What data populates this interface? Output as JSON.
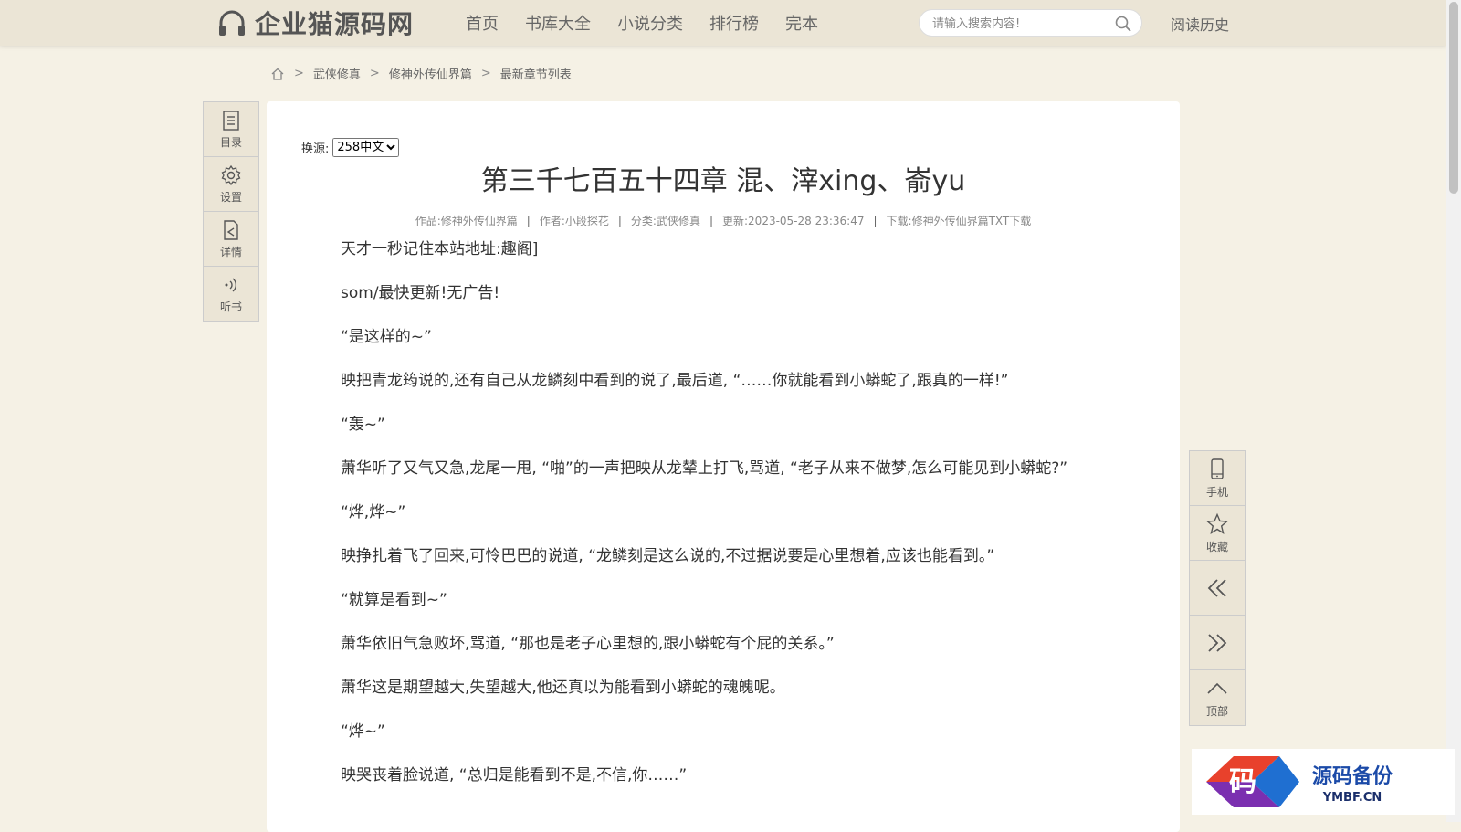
{
  "header": {
    "logo_text": "企业猫源码网",
    "nav": [
      "首页",
      "书库大全",
      "小说分类",
      "排行榜",
      "完本"
    ],
    "search_placeholder": "请输入搜索内容!",
    "history": "阅读历史"
  },
  "breadcrumb": [
    "武侠修真",
    "修神外传仙界篇",
    "最新章节列表"
  ],
  "left_tools": [
    {
      "icon": "list-icon",
      "label": "目录"
    },
    {
      "icon": "gear-icon",
      "label": "设置"
    },
    {
      "icon": "detail-icon",
      "label": "详情"
    },
    {
      "icon": "audio-icon",
      "label": "听书"
    }
  ],
  "source": {
    "label": "换源:",
    "selected": "258中文"
  },
  "chapter": {
    "title": "第三千七百五十四章 混、滓xing、嵛yu",
    "meta": [
      "作品:修神外传仙界篇",
      "作者:小段探花",
      "分类:武侠修真",
      "更新:2023-05-28 23:36:47",
      "下载:修神外传仙界篇TXT下载"
    ],
    "paragraphs": [
      "天才一秒记住本站地址:趣阁]",
      "som/最快更新!无广告!",
      "“是这样的~”",
      "映把青龙筠说的,还有自己从龙鳞刻中看到的说了,最后道, “……你就能看到小蟒蛇了,跟真的一样!”",
      "“轰~”",
      "萧华听了又气又急,龙尾一甩, “啪”的一声把映从龙辇上打飞,骂道, “老子从来不做梦,怎么可能见到小蟒蛇?”",
      "“烨,烨~”",
      "映挣扎着飞了回来,可怜巴巴的说道, “龙鳞刻是这么说的,不过据说要是心里想着,应该也能看到。”",
      "“就算是看到~”",
      "萧华依旧气急败坏,骂道, “那也是老子心里想的,跟小蟒蛇有个屁的关系。”",
      "萧华这是期望越大,失望越大,他还真以为能看到小蟒蛇的魂魄呢。",
      "“烨~”",
      "映哭丧着脸说道, “总归是能看到不是,不信,你……”"
    ]
  },
  "right_tools": [
    {
      "icon": "phone-icon",
      "label": "手机"
    },
    {
      "icon": "star-icon",
      "label": "收藏"
    },
    {
      "icon": "double-chevron-left-icon",
      "label": ""
    },
    {
      "icon": "double-chevron-right-icon",
      "label": ""
    },
    {
      "icon": "chevron-up-icon",
      "label": "顶部"
    }
  ],
  "watermark": {
    "cn": "源码备份",
    "en": "YMBF.CN",
    "logo_char": "码"
  }
}
